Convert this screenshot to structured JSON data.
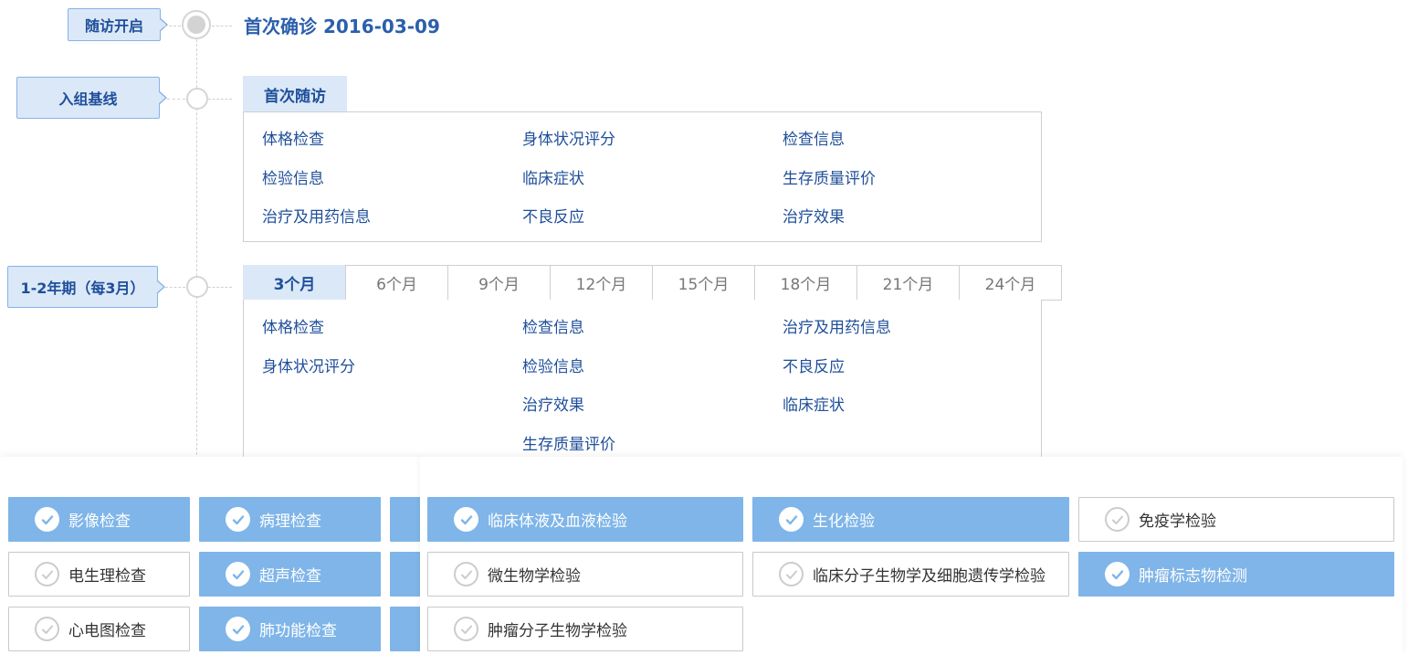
{
  "timeline": {
    "start_tag": "随访开启",
    "first_diagnosis": "首次确诊 2016-03-09",
    "baseline_tag": "入组基线",
    "period_tag": "1-2年期（每3月）"
  },
  "first_visit": {
    "tab_label": "首次随访",
    "items": [
      "体格检查",
      "身体状况评分",
      "检查信息",
      "检验信息",
      "临床症状",
      "生存质量评价",
      "治疗及用药信息",
      "不良反应",
      "治疗效果"
    ]
  },
  "period": {
    "months": [
      "3个月",
      "6个月",
      "9个月",
      "12个月",
      "15个月",
      "18个月",
      "21个月",
      "24个月"
    ],
    "active_month": "3个月",
    "items": {
      "col1": [
        "体格检查",
        "身体状况评分"
      ],
      "col2": [
        "检查信息",
        "检验信息",
        "治疗效果",
        "生存质量评价"
      ],
      "col3": [
        "治疗及用药信息",
        "不良反应",
        "临床症状"
      ]
    }
  },
  "exam_categories": [
    {
      "label": "影像检查",
      "checked": true
    },
    {
      "label": "病理检查",
      "checked": true
    },
    {
      "label": "电生理检查",
      "checked": false
    },
    {
      "label": "超声检查",
      "checked": true
    },
    {
      "label": "心电图检查",
      "checked": false
    },
    {
      "label": "肺功能检查",
      "checked": true
    }
  ],
  "lab_categories": [
    {
      "label": "临床体液及血液检验",
      "checked": true
    },
    {
      "label": "生化检验",
      "checked": true
    },
    {
      "label": "免疫学检验",
      "checked": false
    },
    {
      "label": "微生物学检验",
      "checked": false
    },
    {
      "label": "临床分子生物学及细胞遗传学检验",
      "checked": false
    },
    {
      "label": "肿瘤标志物检测",
      "checked": true
    },
    {
      "label": "肿瘤分子生物学检验",
      "checked": false
    }
  ],
  "colors": {
    "accent": "#1f4f9a",
    "tag_bg": "#dbe8f8",
    "checked_bg": "#7fb5e8",
    "border": "#cfcfcf"
  },
  "icons": {
    "check": "check-circle-icon"
  }
}
